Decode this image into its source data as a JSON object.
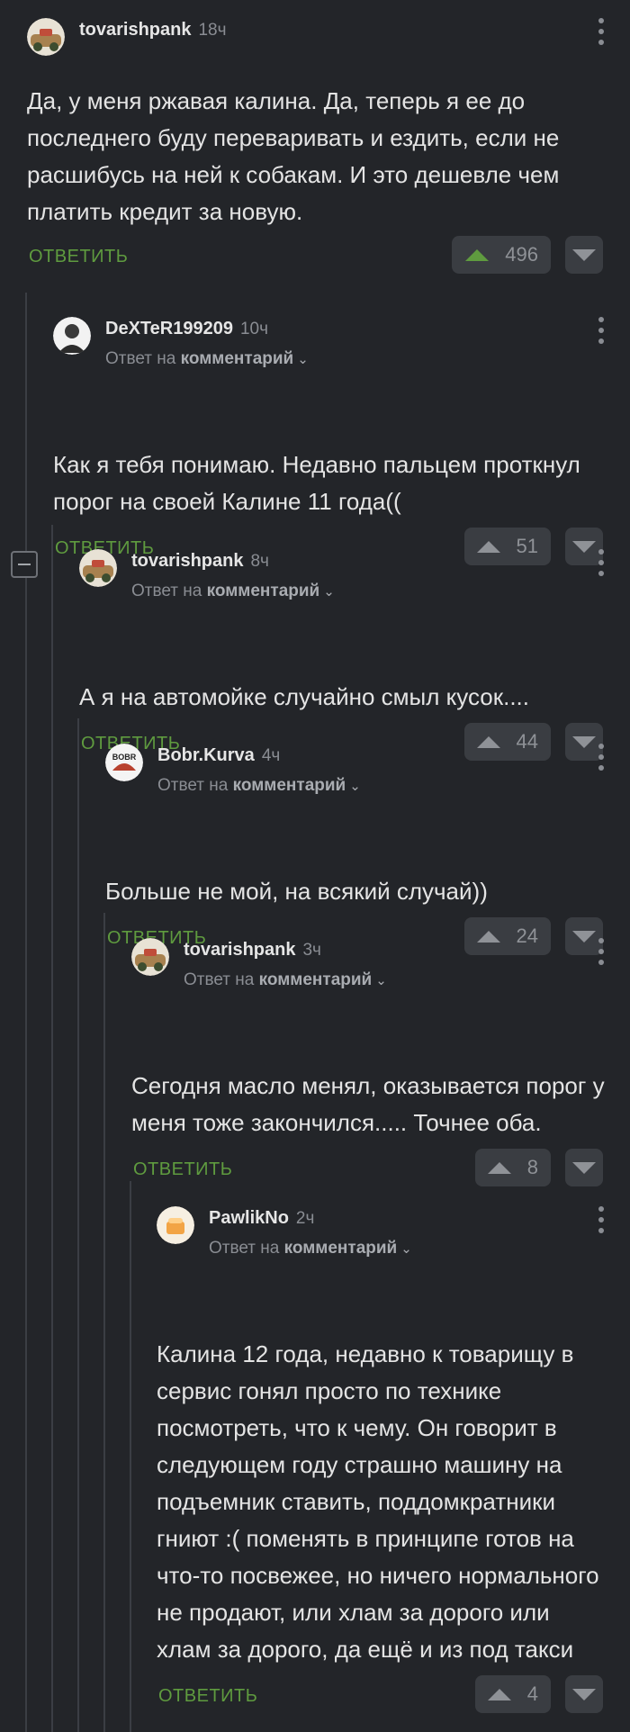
{
  "comments": [
    {
      "user": "tovarishpank",
      "time": "18ч",
      "text": "Да, у меня ржавая калина. Да, теперь я ее до последнего буду переваривать и ездить, если не расшибусь на ней к собакам. И это дешевле чем платить кредит за новую.",
      "reply_label": "ОТВЕТИТЬ",
      "votes": "496"
    },
    {
      "user": "DeXTeR199209",
      "time": "10ч",
      "reply_to_prefix": "Ответ на",
      "reply_to_target": "комментарий",
      "text": "Как я тебя понимаю. Недавно пальцем проткнул порог на своей Калине 11 года((",
      "reply_label": "ОТВЕТИТЬ",
      "votes": "51"
    },
    {
      "user": "tovarishpank",
      "time": "8ч",
      "reply_to_prefix": "Ответ на",
      "reply_to_target": "комментарий",
      "text": "А я на автомойке случайно смыл кусок....",
      "reply_label": "ОТВЕТИТЬ",
      "votes": "44"
    },
    {
      "user": "Bobr.Kurva",
      "time": "4ч",
      "reply_to_prefix": "Ответ на",
      "reply_to_target": "комментарий",
      "text": "Больше не мой, на всякий случай))",
      "reply_label": "ОТВЕТИТЬ",
      "votes": "24",
      "avatar_text": "BOBR"
    },
    {
      "user": "tovarishpank",
      "time": "3ч",
      "reply_to_prefix": "Ответ на",
      "reply_to_target": "комментарий",
      "text": "Сегодня масло менял, оказывается порог у меня тоже закончился..... Точнее оба.",
      "reply_label": "ОТВЕТИТЬ",
      "votes": "8"
    },
    {
      "user": "PawlikNo",
      "time": "2ч",
      "reply_to_prefix": "Ответ на",
      "reply_to_target": "комментарий",
      "text": "Калина 12 года, недавно к товарищу в сервис гонял просто по технике посмотреть, что к чему. Он говорит в следующем году страшно машину на подъемник ставить, поддомкратники гниют :( поменять в принципе готов на что-то посвежее, но ничего нормального не продают, или хлам за дорого или хлам за дорого, да ещё и из под такси",
      "reply_label": "ОТВЕТИТЬ",
      "votes": "4"
    }
  ],
  "colors": {
    "background": "#232529",
    "reply_green": "#5f9b3f",
    "vote_bg": "#3a3d42"
  }
}
